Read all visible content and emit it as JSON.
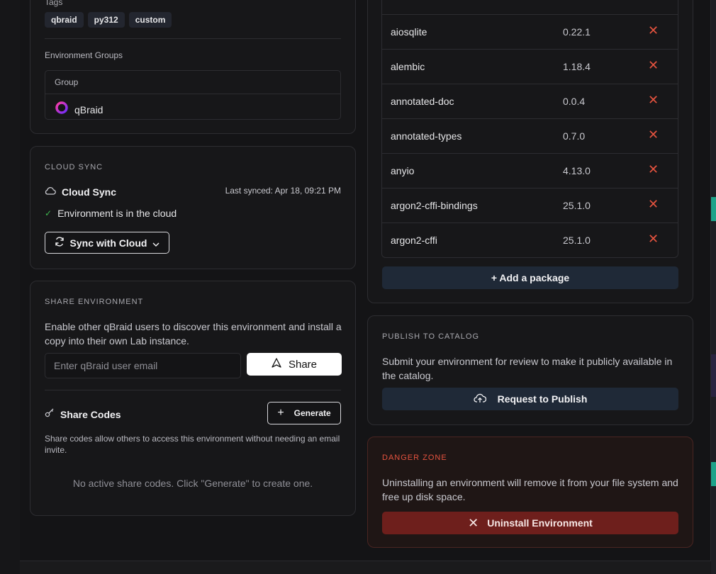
{
  "tags": {
    "label": "Tags",
    "items": [
      "qbraid",
      "py312",
      "custom"
    ]
  },
  "environment_groups": {
    "label": "Environment Groups",
    "header": "Group",
    "group_name": "qBraid"
  },
  "cloud_sync": {
    "section_title": "CLOUD SYNC",
    "title": "Cloud Sync",
    "last_synced": "Last synced: Apr 18, 09:21 PM",
    "status": "Environment is in the cloud",
    "button_label": "Sync with Cloud"
  },
  "share": {
    "section_title": "SHARE ENVIRONMENT",
    "description": "Enable other qBraid users to discover this environment and install a copy into their own Lab instance.",
    "email_placeholder": "Enter qBraid user email",
    "share_label": "Share",
    "codes_title": "Share Codes",
    "generate_label": "Generate",
    "codes_description": "Share codes allow others to access this environment without needing an email invite.",
    "empty_text": "No active share codes. Click \"Generate\" to create one."
  },
  "packages": {
    "rows": [
      {
        "name": "aiosqlite",
        "version": "0.22.1"
      },
      {
        "name": "alembic",
        "version": "1.18.4"
      },
      {
        "name": "annotated-doc",
        "version": "0.0.4"
      },
      {
        "name": "annotated-types",
        "version": "0.7.0"
      },
      {
        "name": "anyio",
        "version": "4.13.0"
      },
      {
        "name": "argon2-cffi-bindings",
        "version": "25.1.0"
      },
      {
        "name": "argon2-cffi",
        "version": "25.1.0"
      }
    ],
    "add_label": "+ Add a package"
  },
  "publish": {
    "section_title": "PUBLISH TO CATALOG",
    "description": "Submit your environment for review to make it publicly available in the catalog.",
    "button_label": "Request to Publish"
  },
  "danger": {
    "section_title": "DANGER ZONE",
    "description": "Uninstalling an environment will remove it from your file system and free up disk space.",
    "button_label": "Uninstall Environment"
  },
  "colors": {
    "accent_green": "#3fb950",
    "danger_red": "#e5533f",
    "danger_bg": "#6e1f1c",
    "navy_button": "#1f2937"
  }
}
